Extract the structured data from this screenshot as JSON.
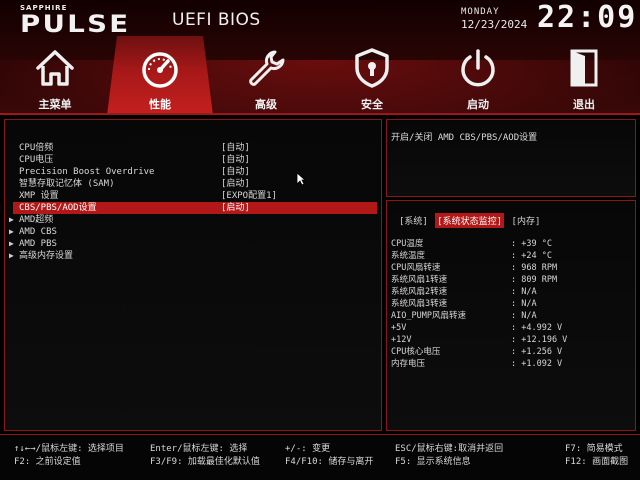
{
  "brand": {
    "small": "SAPPHIRE",
    "main": "PULSE",
    "title": "UEFI BIOS"
  },
  "clock": {
    "weekday": "MONDAY",
    "date": "12/23/2024",
    "time": "22:09"
  },
  "nav": [
    {
      "label": "主菜单",
      "icon": "home-icon"
    },
    {
      "label": "性能",
      "icon": "speedometer-icon",
      "active": true
    },
    {
      "label": "高级",
      "icon": "wrench-icon"
    },
    {
      "label": "安全",
      "icon": "shield-lock-icon"
    },
    {
      "label": "启动",
      "icon": "power-icon"
    },
    {
      "label": "退出",
      "icon": "exit-door-icon"
    }
  ],
  "menu": {
    "items": [
      {
        "name": "CPU倍频",
        "value": "[自动]"
      },
      {
        "name": "CPU电压",
        "value": "[自动]"
      },
      {
        "name": "Precision Boost Overdrive",
        "value": "[自动]"
      },
      {
        "name": "智慧存取记忆体 (SAM)",
        "value": "[启动]"
      },
      {
        "name": "XMP 设置",
        "value": "[EXPO配置1]"
      },
      {
        "name": "CBS/PBS/AOD设置",
        "value": "[启动]",
        "selected": true
      },
      {
        "name": "AMD超频",
        "value": ""
      },
      {
        "name": "AMD CBS",
        "value": ""
      },
      {
        "name": "AMD PBS",
        "value": ""
      },
      {
        "name": "高级内存设置",
        "value": ""
      }
    ]
  },
  "help": {
    "text": "开启/关闭 AMD CBS/PBS/AOD设置"
  },
  "status": {
    "tabs": [
      "[系统]",
      "[系统状态监控]",
      "[内存]"
    ],
    "active_tab": 1,
    "rows": [
      {
        "k": "CPU温度",
        "v": ": +39 °C"
      },
      {
        "k": "系统温度",
        "v": ": +24 °C"
      },
      {
        "k": "CPU风扇转速",
        "v": ": 968 RPM"
      },
      {
        "k": "系统风扇1转速",
        "v": ": 809 RPM"
      },
      {
        "k": "系统风扇2转速",
        "v": ": N/A"
      },
      {
        "k": "系统风扇3转速",
        "v": ": N/A"
      },
      {
        "k": "AIO_PUMP风扇转速",
        "v": ": N/A"
      },
      {
        "k": "+5V",
        "v": ": +4.992 V"
      },
      {
        "k": "+12V",
        "v": ": +12.196 V"
      },
      {
        "k": "CPU核心电压",
        "v": ": +1.256 V"
      },
      {
        "k": "内存电压",
        "v": ": +1.092 V"
      }
    ]
  },
  "footer": {
    "k1": "↑↓←→/鼠标左键: 选择项目",
    "k2": "F2: 之前设定值",
    "k3": "Enter/鼠标左键: 选择",
    "k4": "F3/F9: 加载最佳化默认值",
    "k5": "+/-: 变更",
    "k6": "F4/F10: 储存与离开",
    "k7": "ESC/鼠标右键:取消并返回",
    "k8": "F5: 显示系统信息",
    "k9": "F7: 简易模式",
    "k10": "F12: 画面截图"
  },
  "colors": {
    "accent": "#b31818",
    "border": "#8a1616"
  }
}
